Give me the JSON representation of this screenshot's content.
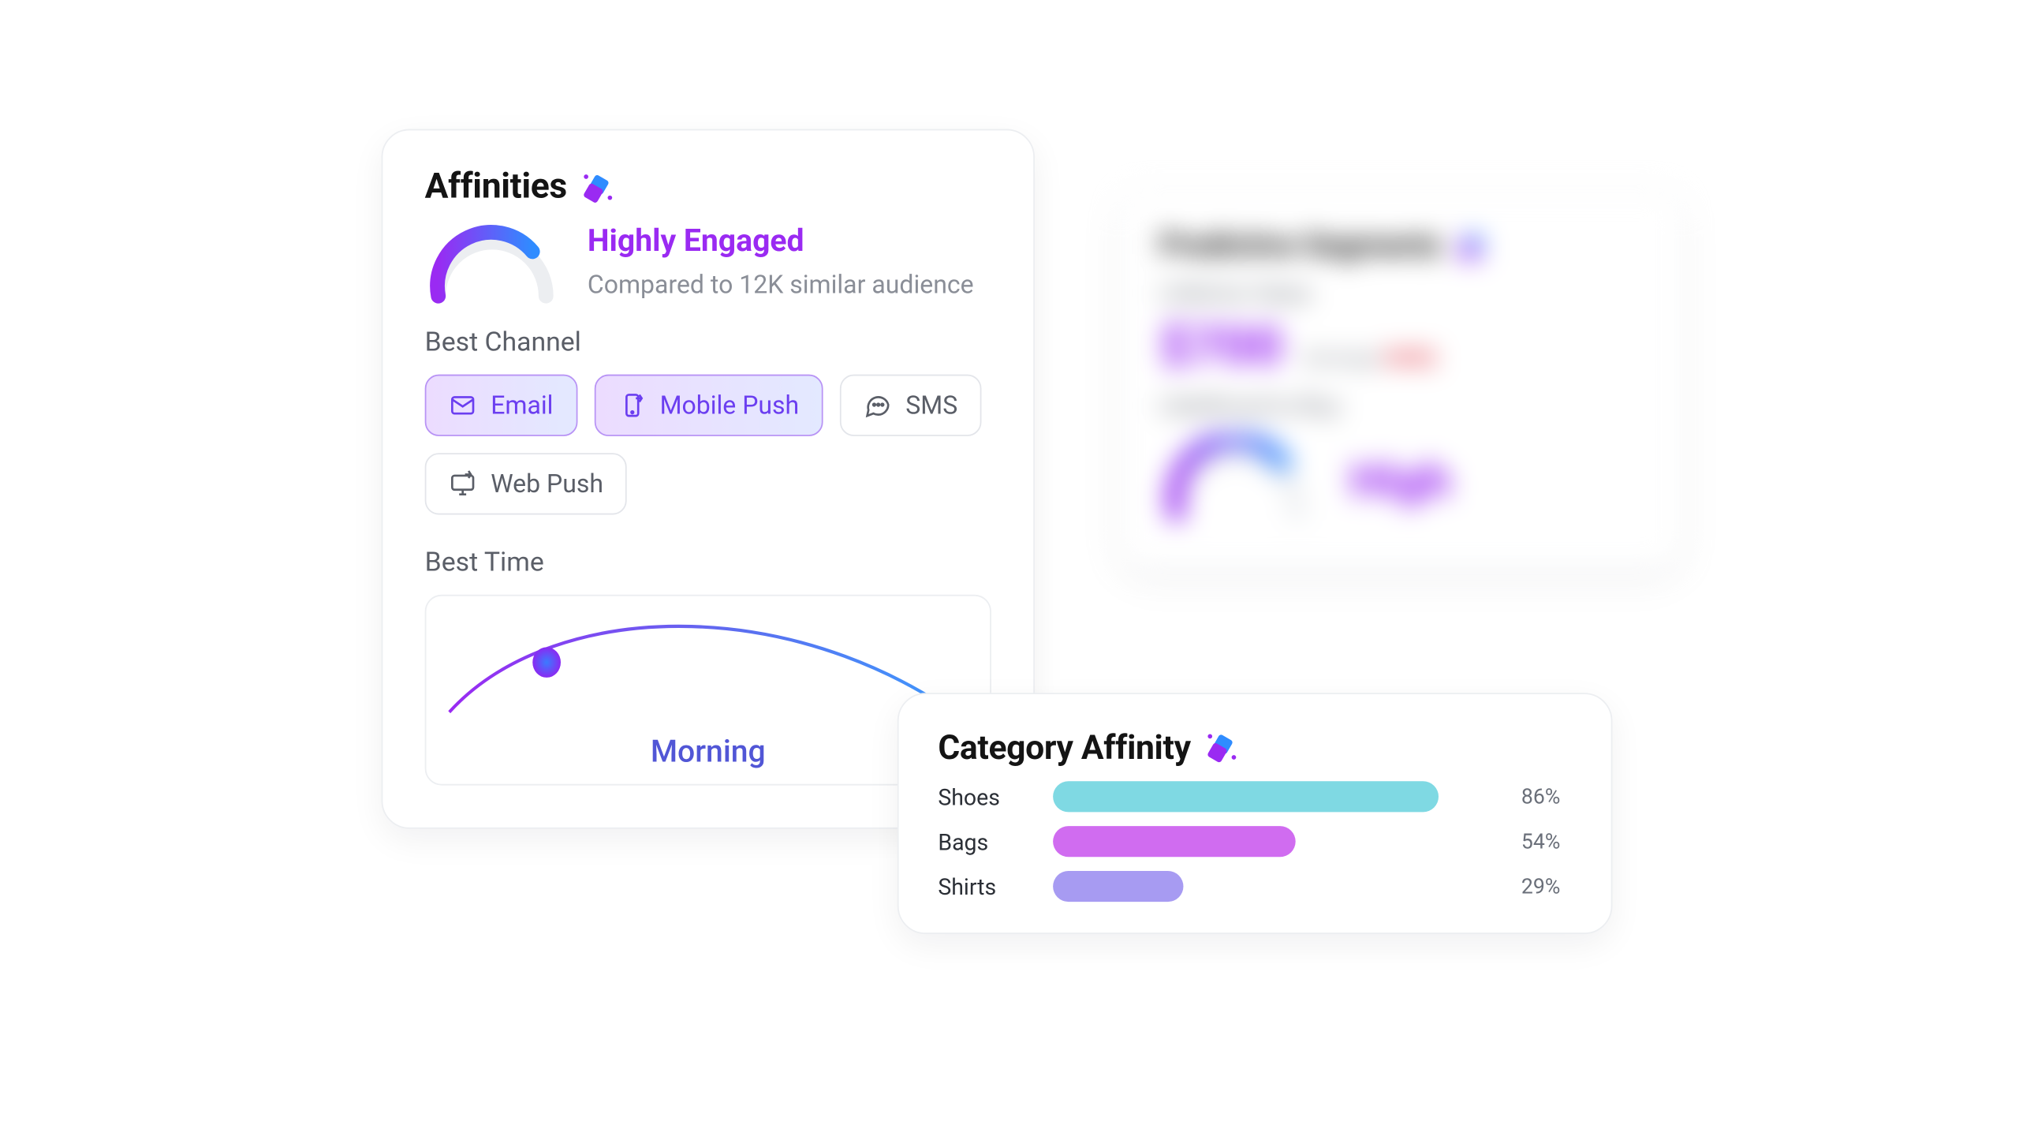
{
  "affinities": {
    "title": "Affinities",
    "status": "Highly Engaged",
    "comparison": "Compared to 12K similar audience",
    "best_channel_label": "Best Channel",
    "channels": {
      "email": "Email",
      "mobile_push": "Mobile Push",
      "sms": "SMS",
      "web_push": "Web Push"
    },
    "best_time_label": "Best Time",
    "best_time_value": "Morning"
  },
  "category_affinity": {
    "title": "Category Affinity"
  },
  "predictive": {
    "title": "Predictive Segments",
    "ltv_label": "Lifetime Value",
    "ltv_value": "$700",
    "avg_label": "(Average",
    "avg_value": "$450)",
    "likelihood_label": "Likelihood to Buy",
    "likelihood_value": "High"
  },
  "chart_data": {
    "type": "bar",
    "title": "Category Affinity",
    "xlabel": "",
    "ylabel": "",
    "ylim": [
      0,
      100
    ],
    "categories": [
      "Shoes",
      "Bags",
      "Shirts"
    ],
    "values": [
      86,
      54,
      29
    ],
    "colors": [
      "#7fd9e3",
      "#d06cf0",
      "#a79bf2"
    ]
  }
}
